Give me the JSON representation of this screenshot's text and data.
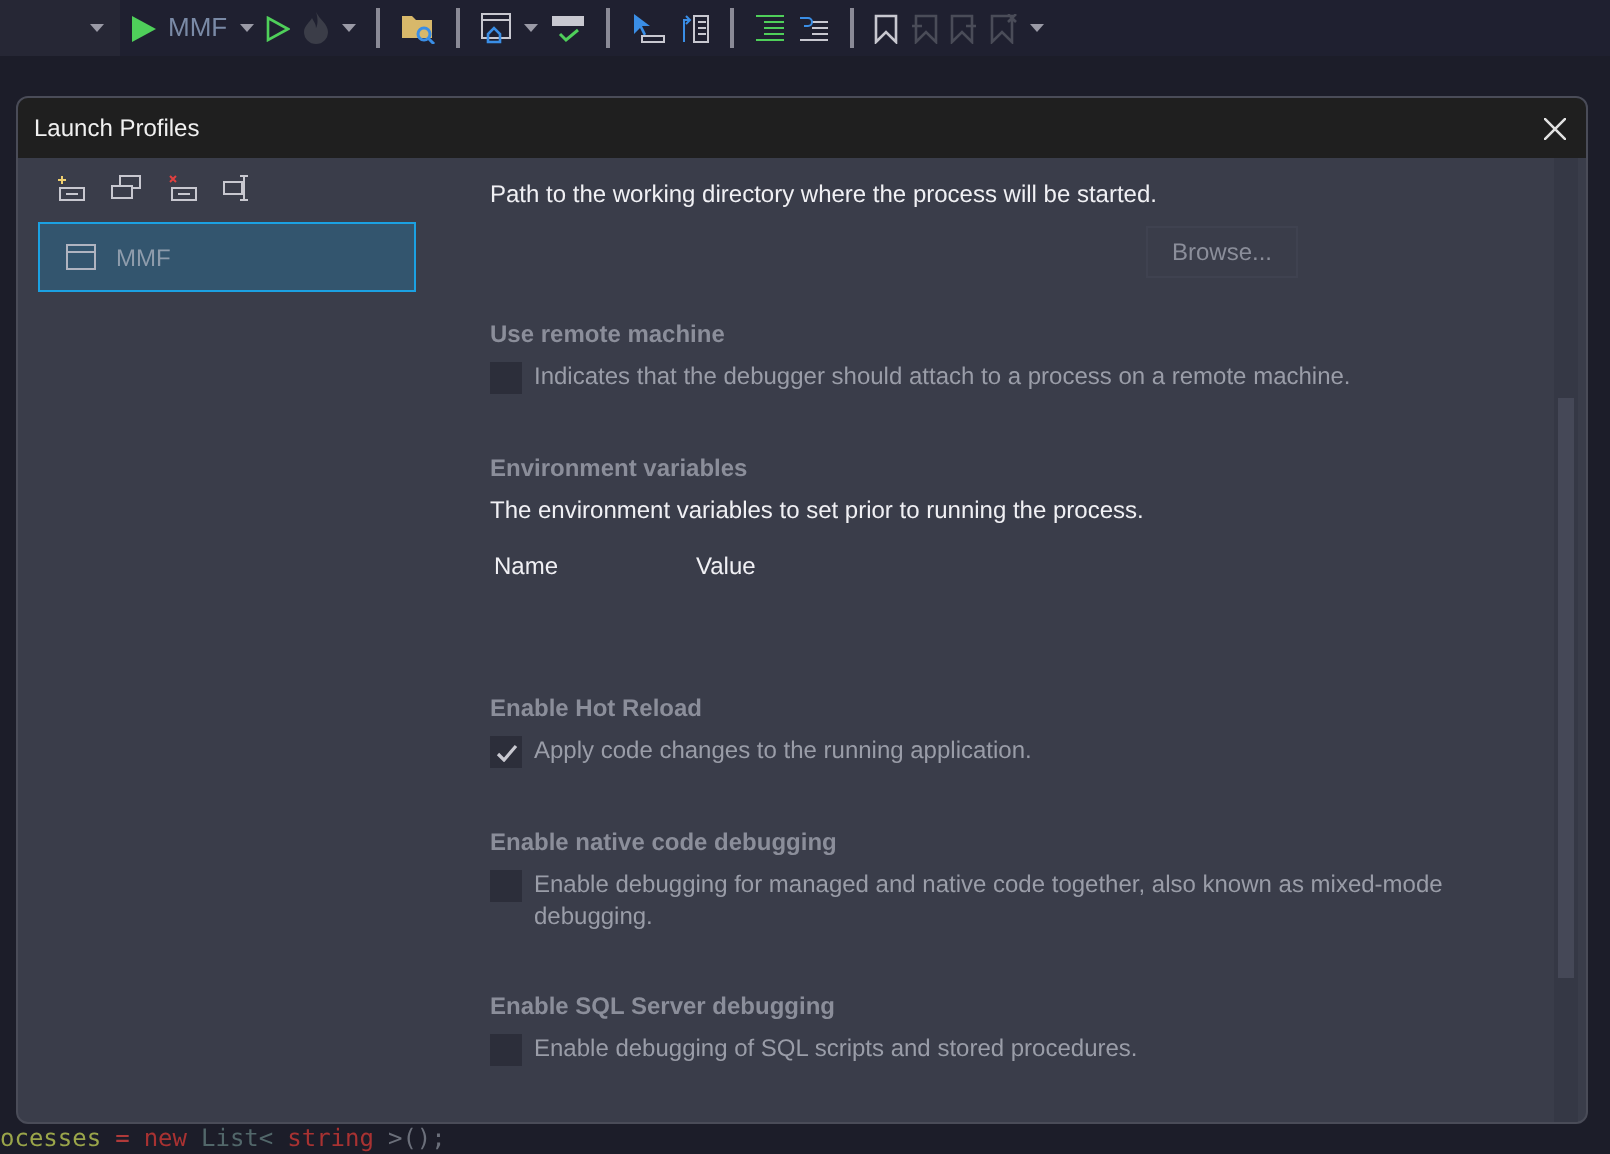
{
  "toolbar": {
    "run_target": "MMF"
  },
  "dialog": {
    "title": "Launch Profiles",
    "profiles": [
      {
        "name": "MMF",
        "selected": true
      }
    ],
    "sections": [
      {
        "kind": "browse",
        "description": "Path to the working directory where the process will be started.",
        "button": "Browse..."
      },
      {
        "kind": "checkbox",
        "title": "Use remote machine",
        "description": "Indicates that the debugger should attach to a process on a remote machine.",
        "checked": false
      },
      {
        "kind": "table",
        "title": "Environment variables",
        "description": "The environment variables to set prior to running the process.",
        "columns": [
          "Name",
          "Value"
        ]
      },
      {
        "kind": "checkbox",
        "title": "Enable Hot Reload",
        "description": "Apply code changes to the running application.",
        "checked": true
      },
      {
        "kind": "checkbox",
        "title": "Enable native code debugging",
        "description": "Enable debugging for managed and native code together, also known as mixed-mode debugging.",
        "checked": false
      },
      {
        "kind": "checkbox",
        "title": "Enable SQL Server debugging",
        "description": "Enable debugging of SQL scripts and stored procedures.",
        "checked": false
      }
    ]
  },
  "code_line": [
    {
      "text": "ocesses",
      "color": "#9aa54a"
    },
    {
      "text": "=",
      "color": "#b03a3a"
    },
    {
      "text": "new",
      "color": "#a83232"
    },
    {
      "text": "List<",
      "color": "#52676a"
    },
    {
      "text": "string",
      "color": "#a83232"
    },
    {
      "text": ">();",
      "color": "#6b6f7a"
    }
  ]
}
